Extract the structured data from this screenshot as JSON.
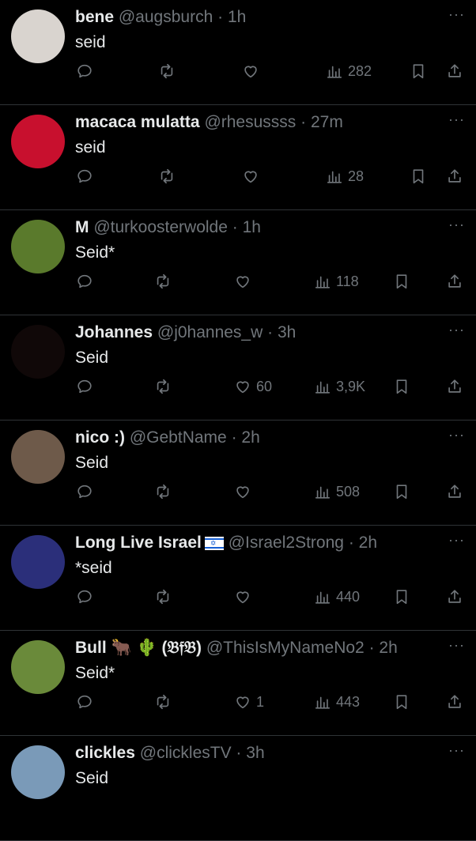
{
  "tweets": [
    {
      "name": "bene",
      "handle": "@augsburch",
      "time": "1h",
      "text": "seid",
      "replies": "",
      "retweets": "",
      "likes": "",
      "views": "282"
    },
    {
      "name": "macaca mulatta",
      "handle": "@rhesussss",
      "time": "27m",
      "text": "seid",
      "replies": "",
      "retweets": "",
      "likes": "",
      "views": "28"
    },
    {
      "name": "M",
      "handle": "@turkoosterwolde",
      "time": "1h",
      "text": "Seid*",
      "replies": "",
      "retweets": "",
      "likes": "",
      "views": "118"
    },
    {
      "name": "Johannes",
      "handle": "@j0hannes_w",
      "time": "3h",
      "text": "Seid",
      "replies": "",
      "retweets": "",
      "likes": "60",
      "views": "3,9K"
    },
    {
      "name": "nico :)",
      "handle": "@GebtName",
      "time": "2h",
      "text": "Seid",
      "replies": "",
      "retweets": "",
      "likes": "",
      "views": "508"
    },
    {
      "name": "Long Live Israel",
      "handle": "@Israel2Strong",
      "time": "2h",
      "text": "*seid",
      "replies": "",
      "retweets": "",
      "likes": "",
      "views": "440"
    },
    {
      "name": "Bull 🐂 🌵 (𝔅𝔣𝔅)",
      "handle": "@ThisIsMyNameNo2",
      "time": "2h",
      "text": "Seid*",
      "replies": "",
      "retweets": "",
      "likes": "1",
      "views": "443"
    },
    {
      "name": "clickles",
      "handle": "@clicklesTV",
      "time": "3h",
      "text": "Seid",
      "replies": "",
      "retweets": "",
      "likes": "",
      "views": ""
    }
  ],
  "separator": "·",
  "more_label": "···",
  "avatar_colors": [
    "#d9d4cf",
    "#c8102e",
    "#5a7a2c",
    "#100808",
    "#6e5a4a",
    "#2b2f7a",
    "#6a8a3a",
    "#7a9ab8"
  ]
}
